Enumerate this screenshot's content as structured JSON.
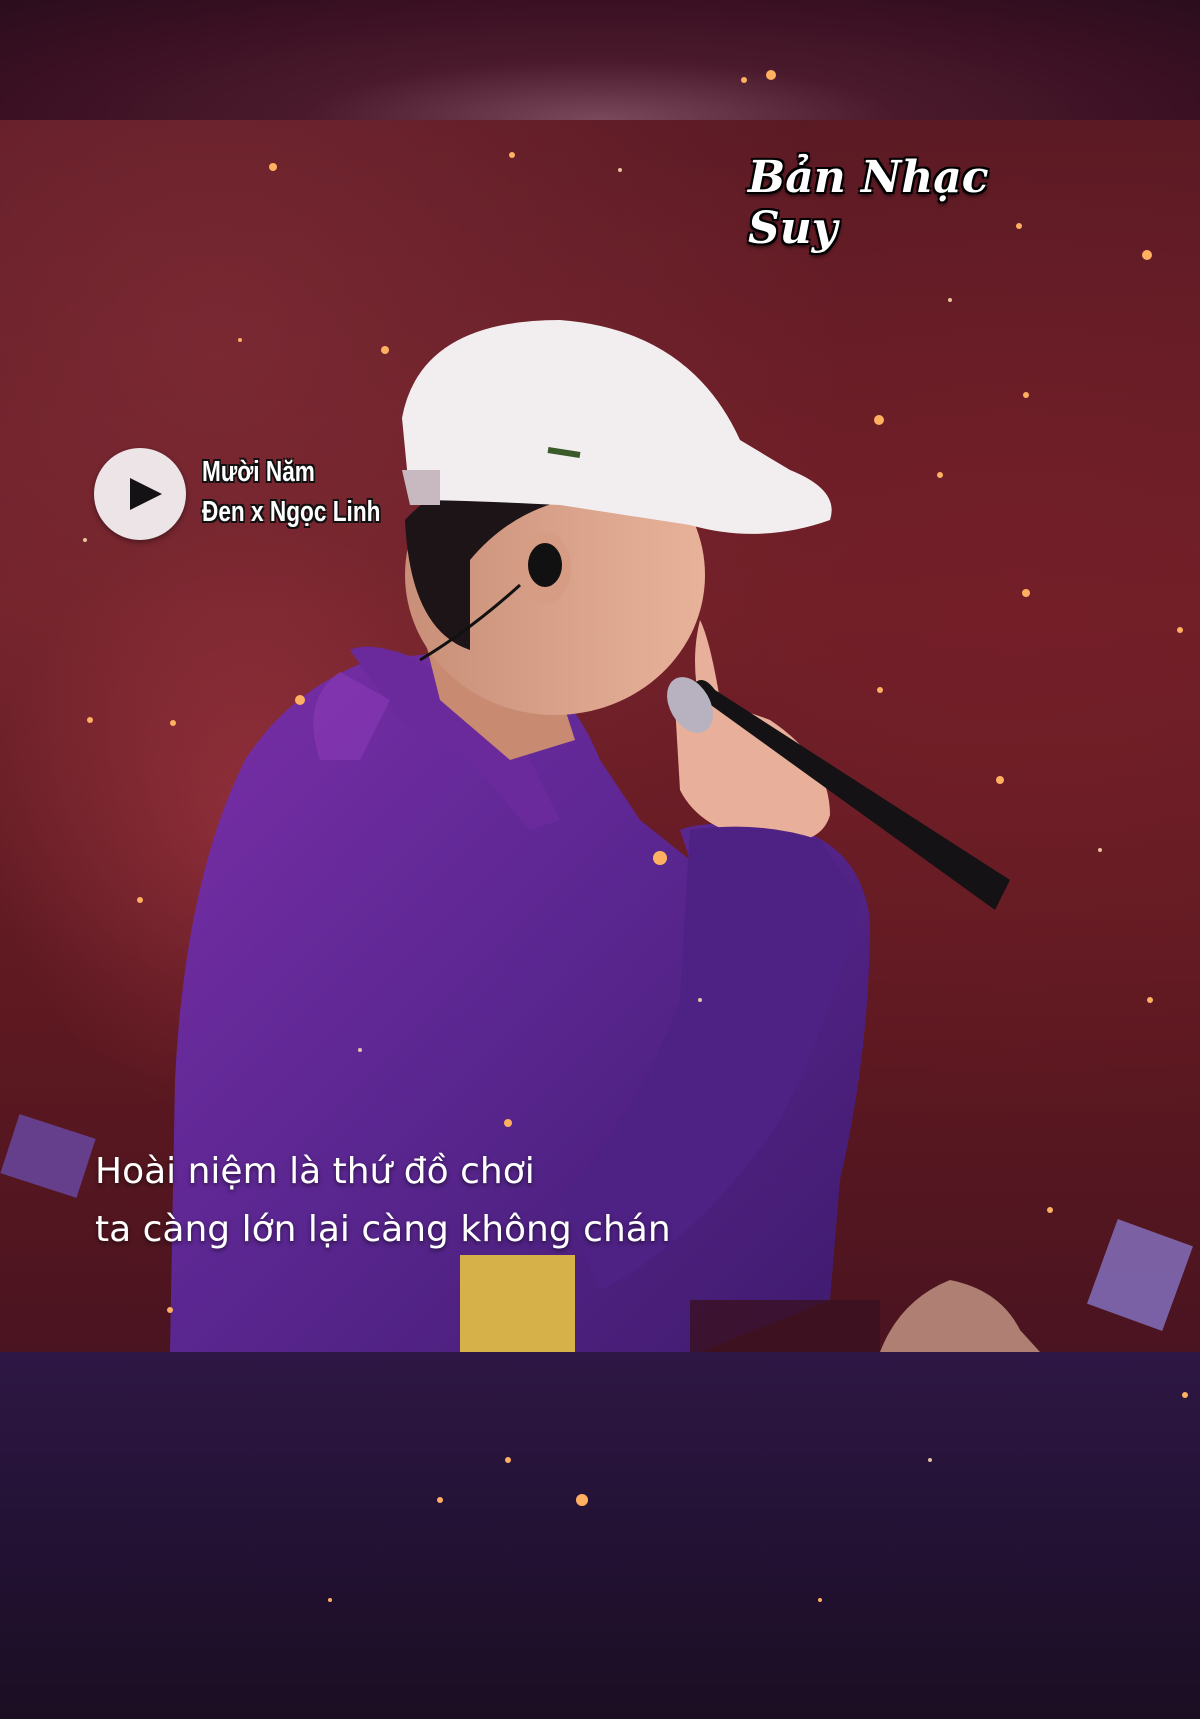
{
  "overlay": {
    "brand": "Bản Nhạc Suy"
  },
  "player": {
    "song_title": "Mười Năm",
    "song_artist": "Đen x Ngọc Linh",
    "play_icon": "play-icon",
    "button_color": "#ece4e6"
  },
  "lyrics": {
    "lines": [
      "Hoài niệm là thứ đồ chơi",
      "ta càng lớn lại càng không chán"
    ]
  },
  "colors": {
    "stage_red": "#6e2028",
    "jacket_purple": "#5a2690",
    "cap_white": "#f2eef0",
    "bottom_purple": "#2e1744"
  }
}
